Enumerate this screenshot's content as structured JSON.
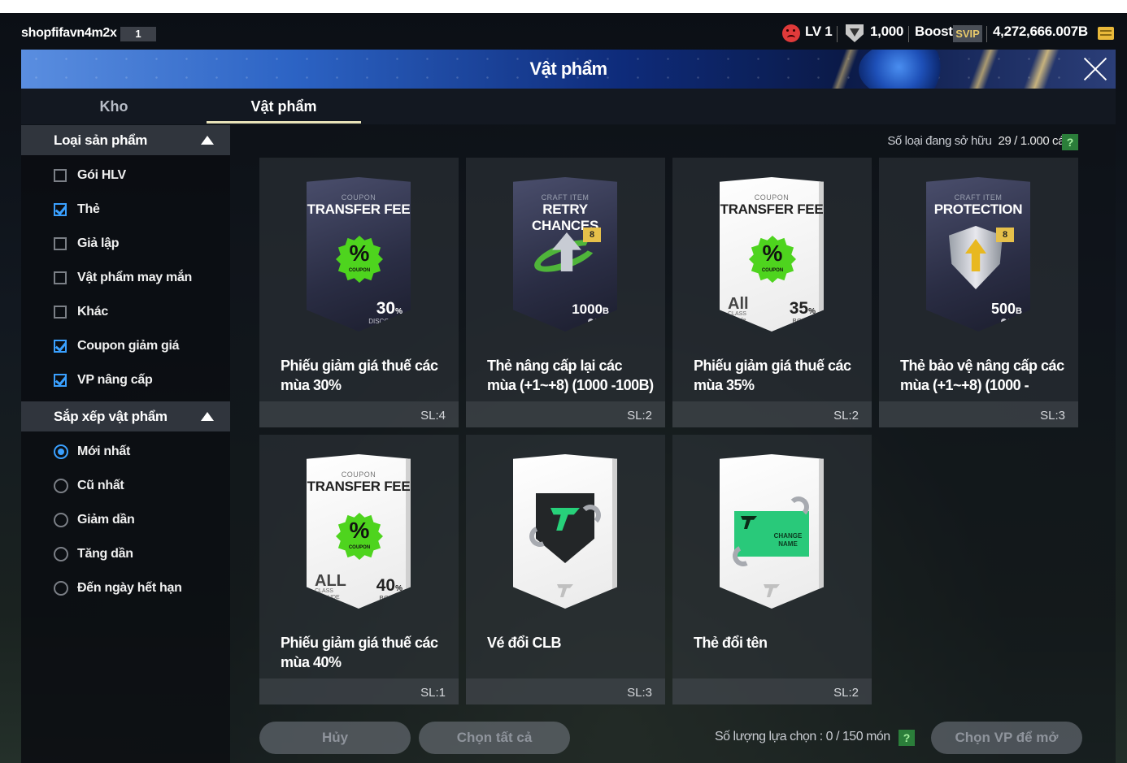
{
  "top_bar": {
    "username": "shopfifavn4m2x",
    "user_level_badge": "1",
    "level": "LV 1",
    "points": "1,000",
    "boost_label": "Boost",
    "svip_label": "SVIP",
    "balance": "4,272,666.007B"
  },
  "header": {
    "title": "Vật phẩm"
  },
  "tabs": [
    {
      "label": "Kho",
      "active": false
    },
    {
      "label": "Vật phẩm",
      "active": true
    }
  ],
  "sidebar": {
    "product_type": {
      "title": "Loại sản phẩm",
      "options": [
        {
          "label": "Gói HLV",
          "checked": false
        },
        {
          "label": "Thẻ",
          "checked": true
        },
        {
          "label": "Giả lập",
          "checked": false
        },
        {
          "label": "Vật phẩm may mắn",
          "checked": false
        },
        {
          "label": "Khác",
          "checked": false
        },
        {
          "label": "Coupon giảm giá",
          "checked": true
        },
        {
          "label": "VP nâng cấp",
          "checked": true
        }
      ]
    },
    "sort": {
      "title": "Sắp xếp vật phẩm",
      "options": [
        {
          "label": "Mới nhất",
          "selected": true
        },
        {
          "label": "Cũ nhất",
          "selected": false
        },
        {
          "label": "Giảm dần",
          "selected": false
        },
        {
          "label": "Tăng dần",
          "selected": false
        },
        {
          "label": "Đến ngày hết hạn",
          "selected": false
        }
      ]
    }
  },
  "main": {
    "owned_label": "Số loại đang sở hữu",
    "owned_value": "29 / 1.000 cái",
    "help_glyph": "?",
    "items": [
      {
        "name": "Phiếu giảm giá thuế các mùa 30%",
        "qty": "SL:4",
        "art": {
          "kicker": "COUPON",
          "title": "TRANSFER FEE",
          "pct": "%",
          "coupon": "COUPON",
          "value": "30",
          "unit": "%",
          "sub": "DISCOUNT"
        }
      },
      {
        "name": "Thẻ nâng cấp lại các mùa (+1~+8) (1000 -100B)",
        "qty": "SL:2",
        "art": {
          "kicker": "CRAFT ITEM",
          "title": "RETRY CHANCES",
          "tag": "8",
          "value": "1000",
          "unit": "B",
          "sub": "MAX"
        }
      },
      {
        "name": "Phiếu giảm giá thuế các mùa 35%",
        "qty": "SL:2",
        "art": {
          "kicker": "COUPON",
          "title": "TRANSFER FEE",
          "pct": "%",
          "coupon": "COUPON",
          "all": "All",
          "allsub": "CLASS Include",
          "value": "35",
          "unit": "%",
          "sub": "BONUS"
        }
      },
      {
        "name": "Thẻ bảo vệ nâng cấp các mùa (+1~+8) (1000 -",
        "qty": "SL:3",
        "art": {
          "kicker": "CRAFT ITEM",
          "title": "PROTECTION",
          "tag": "8",
          "value": "500",
          "unit": "B",
          "sub": "MAX"
        }
      },
      {
        "name": "Phiếu giảm giá thuế các mùa 40%",
        "qty": "SL:1",
        "art": {
          "kicker": "COUPON",
          "title": "TRANSFER FEE",
          "pct": "%",
          "coupon": "COUPON",
          "all": "ALL",
          "allsub": "CLASS INCLUDE",
          "value": "40",
          "unit": "%",
          "sub": "BONUS"
        }
      },
      {
        "name": "Vé đổi CLB",
        "qty": "SL:3"
      },
      {
        "name": "Thẻ đổi tên",
        "qty": "SL:2",
        "art": {
          "ticket_text": "CHANGE NAME"
        }
      }
    ]
  },
  "footer": {
    "cancel_label": "Hủy",
    "select_all_label": "Chọn tất cả",
    "selection_count": "Số lượng lựa chọn : 0 / 150 món",
    "open_label": "Chọn VP để mở"
  }
}
